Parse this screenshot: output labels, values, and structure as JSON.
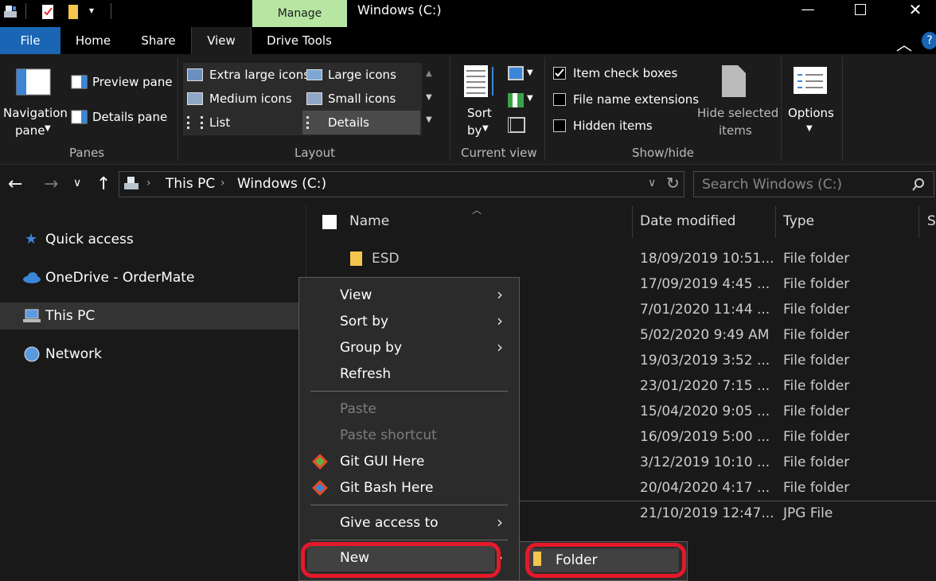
{
  "window": {
    "title": "Windows (C:)",
    "manage_tab": "Manage"
  },
  "tabs": {
    "file": "File",
    "home": "Home",
    "share": "Share",
    "view": "View",
    "drive_tools": "Drive Tools"
  },
  "ribbon": {
    "panes": {
      "navigation_pane_line1": "Navigation",
      "navigation_pane_line2": "pane",
      "preview_pane": "Preview pane",
      "details_pane": "Details pane",
      "group": "Panes"
    },
    "layout": {
      "extra_large": "Extra large icons",
      "large": "Large icons",
      "medium": "Medium icons",
      "small": "Small icons",
      "list": "List",
      "details": "Details",
      "group": "Layout"
    },
    "current_view": {
      "sort_line1": "Sort",
      "sort_line2": "by",
      "group": "Current view"
    },
    "show_hide": {
      "item_check_boxes": "Item check boxes",
      "file_name_extensions": "File name extensions",
      "hidden_items": "Hidden items",
      "hide_selected_line1": "Hide selected",
      "hide_selected_line2": "items",
      "group": "Show/hide",
      "item_check_boxes_checked": true
    },
    "options": {
      "label": "Options"
    }
  },
  "address": {
    "crumb1": "This PC",
    "crumb2": "Windows (C:)",
    "search_placeholder": "Search Windows (C:)"
  },
  "nav": {
    "quick_access": "Quick access",
    "onedrive": "OneDrive - OrderMate",
    "this_pc": "This PC",
    "network": "Network"
  },
  "columns": {
    "name": "Name",
    "date_modified": "Date modified",
    "type": "Type",
    "size": "Si"
  },
  "files": [
    {
      "name": "ESD",
      "date": "18/09/2019 10:51...",
      "type": "File folder"
    },
    {
      "name": "",
      "date": "17/09/2019 4:45 ...",
      "type": "File folder"
    },
    {
      "name": "",
      "date": "7/01/2020 11:44 ...",
      "type": "File folder"
    },
    {
      "name": "",
      "date": "5/02/2020 9:49 AM",
      "type": "File folder"
    },
    {
      "name": "",
      "date": "19/03/2019 3:52 ...",
      "type": "File folder"
    },
    {
      "name": "",
      "date": "23/01/2020 7:15 ...",
      "type": "File folder"
    },
    {
      "name": "",
      "date": "15/04/2020 9:05 ...",
      "type": "File folder"
    },
    {
      "name": "",
      "date": "16/09/2019 5:00 ...",
      "type": "File folder"
    },
    {
      "name": "",
      "date": "3/12/2019 10:10 ...",
      "type": "File folder"
    },
    {
      "name": "",
      "date": "20/04/2020 4:17 ...",
      "type": "File folder"
    },
    {
      "name": "",
      "date": "21/10/2019 12:47...",
      "type": "JPG File"
    }
  ],
  "context_menu": {
    "view": "View",
    "sort_by": "Sort by",
    "group_by": "Group by",
    "refresh": "Refresh",
    "paste": "Paste",
    "paste_shortcut": "Paste shortcut",
    "git_gui": "Git GUI Here",
    "git_bash": "Git Bash Here",
    "give_access": "Give access to",
    "new": "New"
  },
  "submenu": {
    "folder": "Folder"
  },
  "colors": {
    "accent": "#1a66b5",
    "manage": "#b7e6a3",
    "highlight": "#e5192a"
  }
}
